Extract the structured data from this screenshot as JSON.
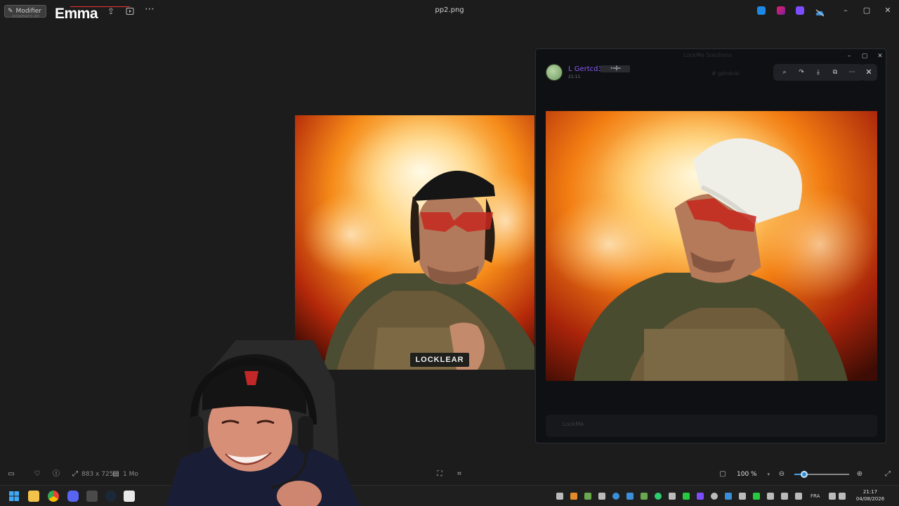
{
  "titlebar": {
    "edit_label": "Modifier",
    "edit_sub": "POWERED BY",
    "brand": "Emma",
    "file_title": "pp2.png",
    "icons": [
      "edit-icon",
      "rotate-icon",
      "delete-icon",
      "share-icon",
      "slideshow-icon",
      "more-icon"
    ],
    "tray_apps": [
      "app-blue",
      "app-pink",
      "app-purple",
      "onedrive-icon"
    ],
    "window_controls": [
      "minimize",
      "maximize",
      "close"
    ]
  },
  "main_photo": {
    "badge_text": "LOCKLEAR"
  },
  "popup": {
    "window_title": "LockMe Solutions",
    "author": "L Gertcd3",
    "time": "21:11",
    "channel": "# général",
    "input_placeholder": "LockMe",
    "toolbar_icons": [
      "zoom-icon",
      "forward-icon",
      "download-icon",
      "open-external-icon",
      "more-icon"
    ]
  },
  "viewerbar": {
    "dimensions": "883 x 725",
    "size": "1 Mo",
    "zoom": "100 %",
    "zoom_level": 0.18
  },
  "taskbar": {
    "lang": "FRA",
    "time": "21:17",
    "date": "04/08/2026",
    "apps": [
      "windows-icon",
      "explorer-icon",
      "chrome-icon",
      "discord-icon",
      "calculator-icon",
      "steam-icon",
      "notepad-icon"
    ]
  },
  "colors": {
    "accent": "#2f8fdb",
    "author": "#8a5cf6",
    "background": "#1c1c1c"
  }
}
